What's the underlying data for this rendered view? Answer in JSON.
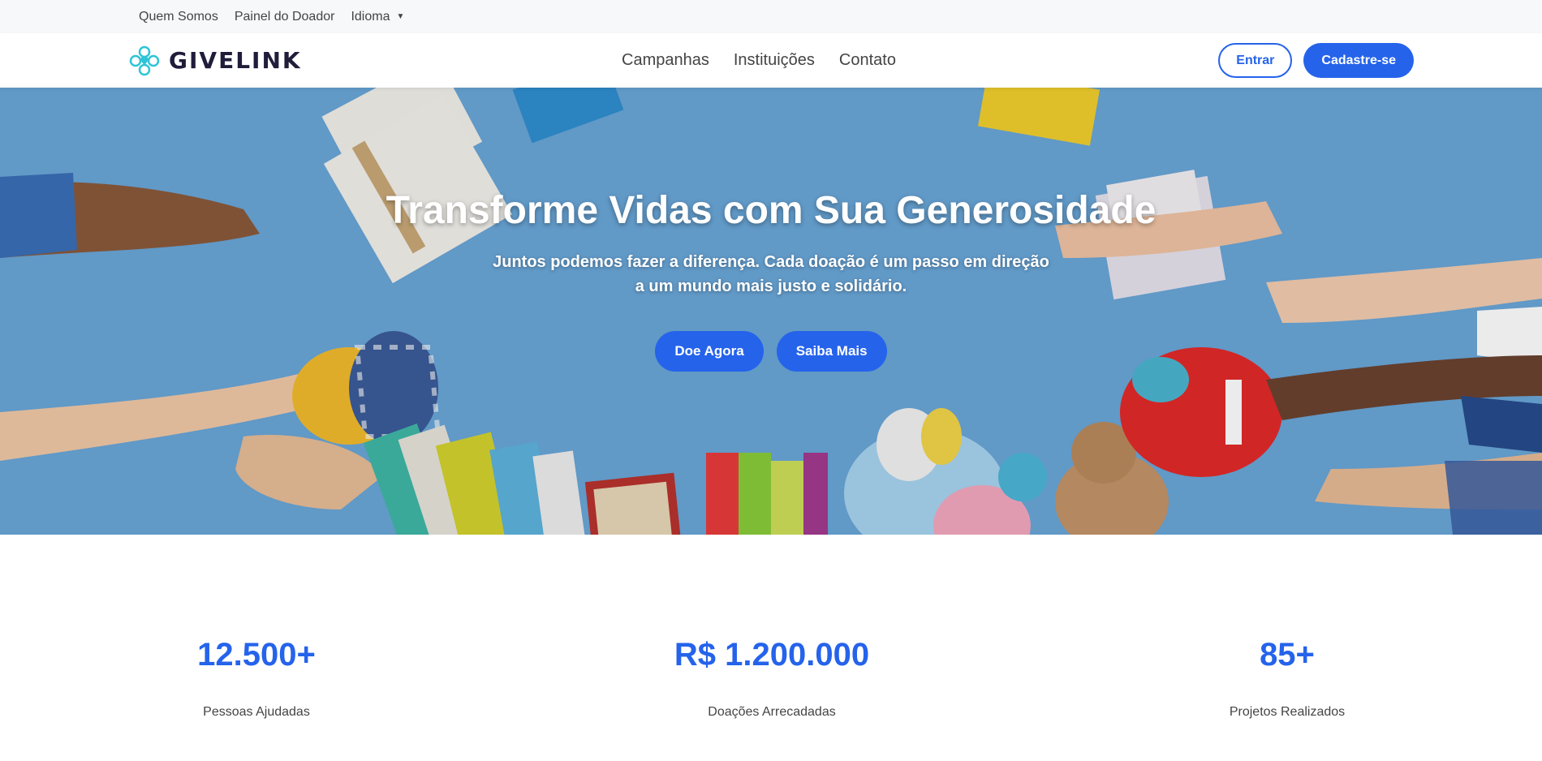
{
  "topbar": {
    "links": [
      "Quem Somos",
      "Painel do Doador"
    ],
    "language_label": "Idioma"
  },
  "header": {
    "brand": "GIVELINK",
    "nav": [
      "Campanhas",
      "Instituições",
      "Contato"
    ],
    "login_label": "Entrar",
    "signup_label": "Cadastre-se"
  },
  "hero": {
    "title": "Transforme Vidas com Sua Generosidade",
    "subtitle_line1": "Juntos podemos fazer a diferença. Cada doação é um passo em direção",
    "subtitle_line2": "a um mundo mais justo e solidário.",
    "donate_label": "Doe Agora",
    "learn_label": "Saiba Mais"
  },
  "stats": [
    {
      "value": "12.500+",
      "label": "Pessoas Ajudadas"
    },
    {
      "value": "R$ 1.200.000",
      "label": "Doações Arrecadadas"
    },
    {
      "value": "85+",
      "label": "Projetos Realizados"
    }
  ],
  "colors": {
    "accent": "#2563eb",
    "brand_teal": "#2ec4d6",
    "brand_dark": "#1f1d3a",
    "hero_bg": "#6aa7d8"
  }
}
